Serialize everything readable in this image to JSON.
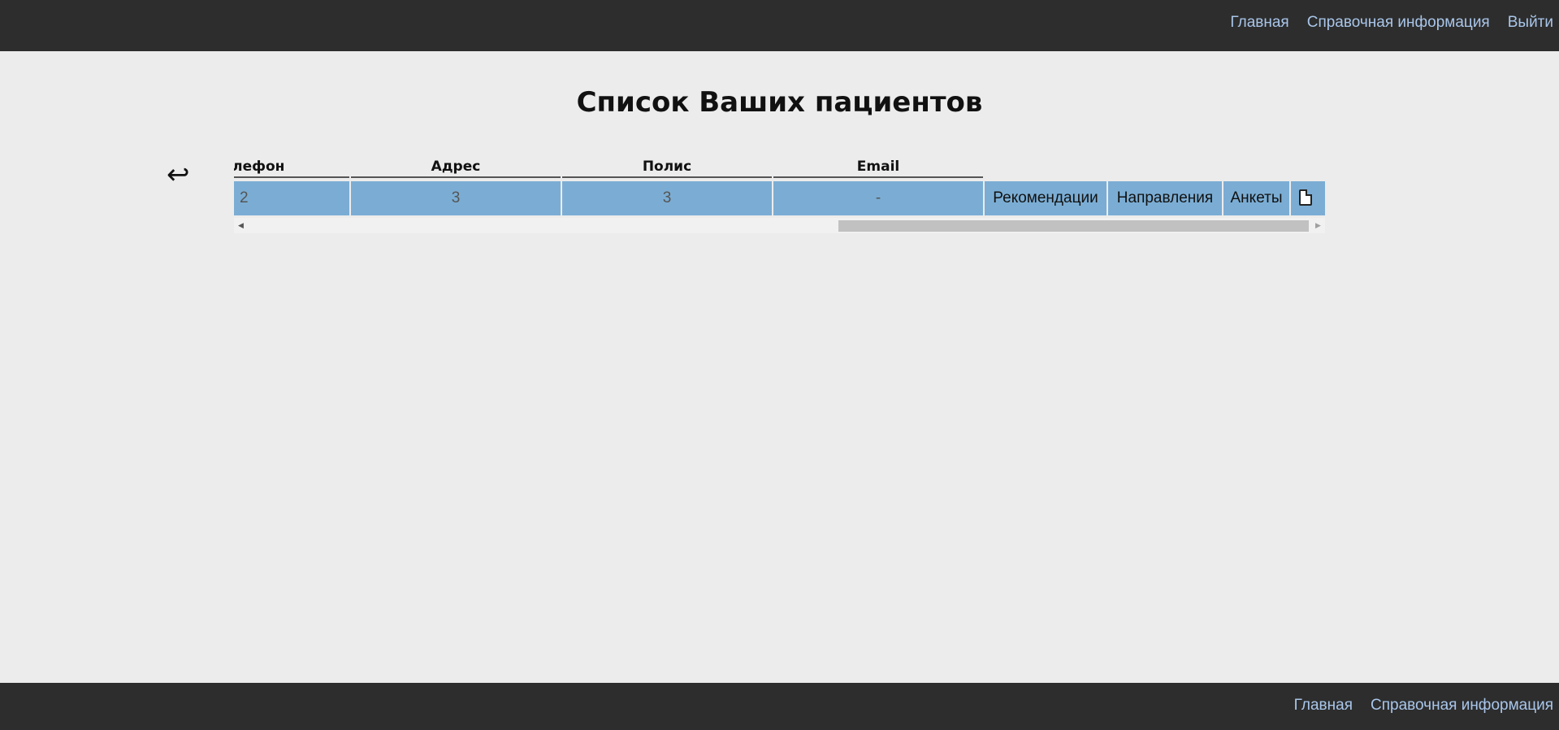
{
  "header": {
    "nav": [
      {
        "label": "Главная"
      },
      {
        "label": "Справочная информация"
      },
      {
        "label": "Выйти"
      }
    ]
  },
  "page_title": "Список Ваших пациентов",
  "back_icon": "return-arrow-icon",
  "table": {
    "columns": [
      "Телефон",
      "Адрес",
      "Полис",
      "Email"
    ],
    "rows": [
      {
        "phone": "2",
        "address": "3",
        "policy": "3",
        "email": "-",
        "actions": [
          "Рекомендации",
          "Направления",
          "Анкеты"
        ],
        "document_icon": "document-icon"
      }
    ]
  },
  "footer": {
    "nav": [
      {
        "label": "Главная"
      },
      {
        "label": "Справочная информация"
      }
    ]
  },
  "colors": {
    "header_bg": "#2d2d2d",
    "link": "#a9c6ea",
    "page_bg": "#ececec",
    "row_bg": "#7badd4"
  }
}
